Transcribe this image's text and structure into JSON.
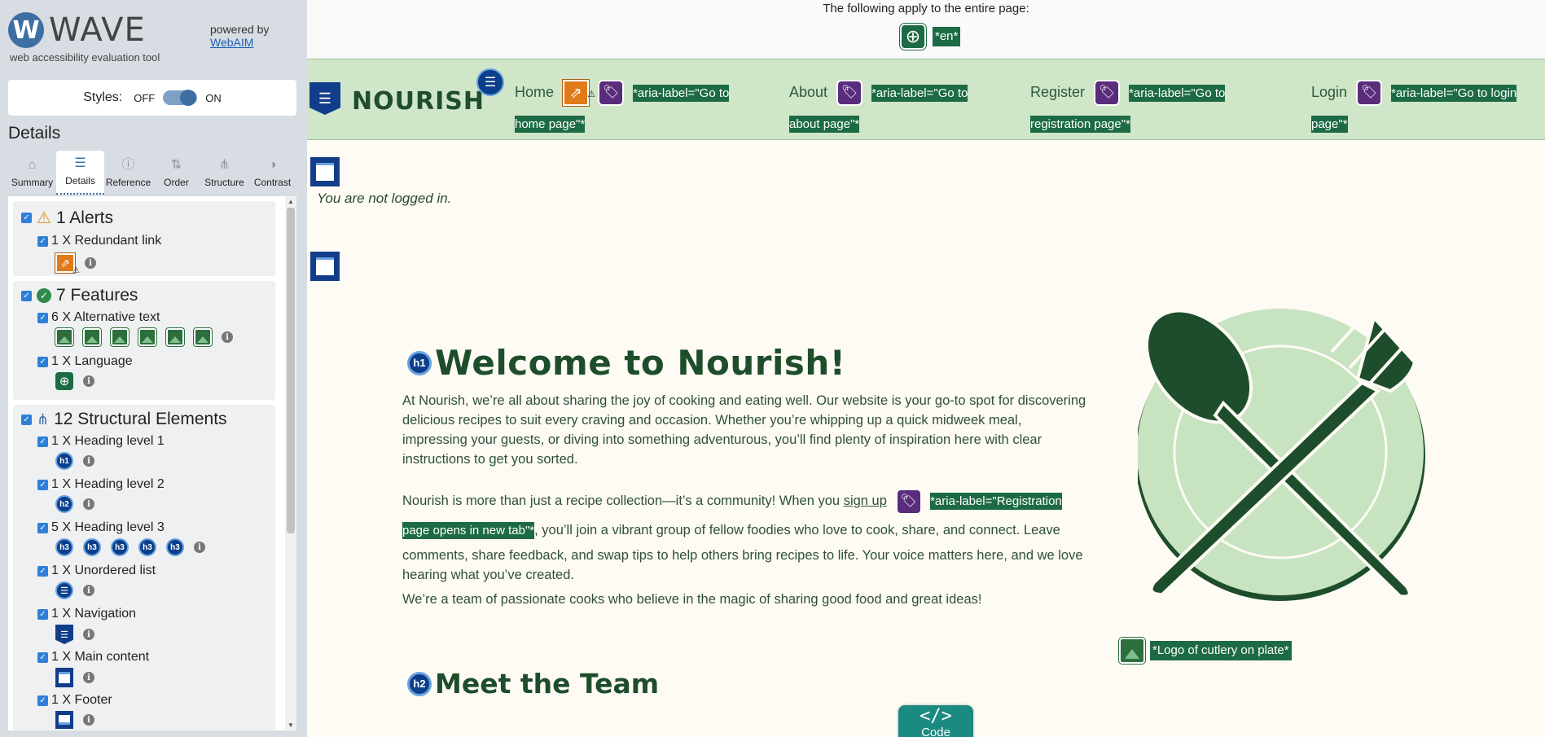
{
  "wave": {
    "logo_letter": "W",
    "logo_word": "WAVE",
    "subtitle": "web accessibility evaluation tool",
    "powered_by": "powered by",
    "webaim": "WebAIM",
    "styles_label": "Styles:",
    "styles_off": "OFF",
    "styles_on": "ON",
    "details_heading": "Details",
    "tabs": [
      {
        "label": "Summary",
        "icon": "home-icon"
      },
      {
        "label": "Details",
        "icon": "list-icon"
      },
      {
        "label": "Reference",
        "icon": "info-icon"
      },
      {
        "label": "Order",
        "icon": "order-icon"
      },
      {
        "label": "Structure",
        "icon": "structure-icon"
      },
      {
        "label": "Contrast",
        "icon": "contrast-icon"
      }
    ],
    "alerts": {
      "title": "1 Alerts",
      "items": [
        {
          "label": "1 X Redundant link"
        }
      ]
    },
    "features": {
      "title": "7 Features",
      "items": [
        {
          "label": "6 X Alternative text"
        },
        {
          "label": "1 X Language"
        }
      ]
    },
    "structure": {
      "title": "12 Structural Elements",
      "items": [
        {
          "label": "1 X Heading level 1"
        },
        {
          "label": "1 X Heading level 2"
        },
        {
          "label": "5 X Heading level 3"
        },
        {
          "label": "1 X Unordered list"
        },
        {
          "label": "1 X Navigation"
        },
        {
          "label": "1 X Main content"
        },
        {
          "label": "1 X Footer"
        }
      ]
    },
    "h1_badge": "h1",
    "h2_badge": "h2",
    "h3_badge": "h3"
  },
  "page": {
    "top_note": "The following apply to the entire page:",
    "lang_tag": "*en*",
    "brand": "NOURISH",
    "nav": [
      {
        "label": "Home",
        "aria": "*aria-label=\"Go to home page\"*"
      },
      {
        "label": "About",
        "aria": "*aria-label=\"Go to about page\"*"
      },
      {
        "label": "Register",
        "aria": "*aria-label=\"Go to registration page\"*"
      },
      {
        "label": "Login",
        "aria": "*aria-label=\"Go to login page\"*"
      }
    ],
    "not_logged_in": "You are not logged in.",
    "h1": "Welcome to Nourish!",
    "para1": "At Nourish, we’re all about sharing the joy of cooking and eating well. Our website is your go-to spot for discovering delicious recipes to suit every craving and occasion. Whether you’re whipping up a quick midweek meal, impressing your guests, or diving into something adventurous, you’ll find plenty of inspiration here with clear instructions to get you sorted.",
    "para2_pre": "Nourish is more than just a recipe collection—it’s a community! When you ",
    "para2_link": "sign up",
    "para2_aria": "*aria-label=\"Registration page opens in new tab\"*",
    "para2_post": ", you’ll join a vibrant group of fellow foodies who love to cook, share, and connect. Leave comments, share feedback, and swap tips to help others bring recipes to life. Your voice matters here, and we love hearing what you’ve created.",
    "para3": "We’re a team of passionate cooks who believe in the magic of sharing good food and great ideas!",
    "img_alt_caption": "*Logo of cutlery on plate*",
    "h2": "Meet the Team",
    "code_tab_symbol": "</>",
    "code_tab_label": "Code"
  },
  "colors": {
    "wave_blue": "#3d6fa3",
    "nav_bg": "#cfe6c8",
    "brand_green": "#1e4d2b",
    "tag_green": "#1d6b45",
    "aria_purple": "#5a2d7c",
    "alert_orange": "#e07b1a"
  }
}
